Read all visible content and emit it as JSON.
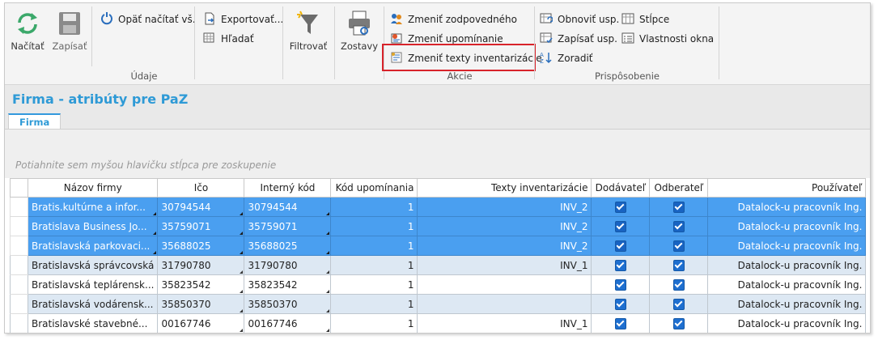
{
  "ribbon": {
    "udaje": {
      "label": "Údaje",
      "nacitat": "Načítať",
      "zapisat": "Zapísať",
      "opat_nacitat": "Opäť načítať vš.",
      "exportovat": "Exportovať...",
      "hladat": "Hľadať"
    },
    "filtrovat": "Filtrovať",
    "zostavy": "Zostavy",
    "akcie": {
      "label": "Akcie",
      "zmenit_zodpovedneho": "Zmeniť zodpovedného",
      "zmenit_upomienanie": "Zmeniť upomínanie",
      "zmenit_texty": "Zmeniť texty inventarizácie"
    },
    "prisposobenie": {
      "label": "Prispôsobenie",
      "obnovit_usp": "Obnoviť usp.",
      "zapisat_usp": "Zapísať usp.",
      "zoradit": "Zoradiť",
      "stlpce": "Stĺpce",
      "vlastnosti_okna": "Vlastnosti okna"
    }
  },
  "page": {
    "title": "Firma - atribúty pre PaZ",
    "tab": "Firma",
    "group_hint": "Potiahnite sem myšou hlavičku stĺpca pre zoskupenie"
  },
  "grid": {
    "columns": [
      "Názov firmy",
      "Ičo",
      "Interný kód",
      "Kód upomínania",
      "Texty inventarizácie",
      "Dodávateľ",
      "Odberateľ",
      "Používateľ"
    ],
    "rows": [
      {
        "nazov": "Bratis.kultúrne a infor...",
        "ico": "30794544",
        "kod": "30794544",
        "upom": "1",
        "texty": "INV_2",
        "user": "Datalock-u pracovník Ing."
      },
      {
        "nazov": "Bratislava Business Jo...",
        "ico": "35759071",
        "kod": "35759071",
        "upom": "1",
        "texty": "INV_2",
        "user": "Datalock-u pracovník Ing."
      },
      {
        "nazov": "Bratislavská parkovaci...",
        "ico": "35688025",
        "kod": "35688025",
        "upom": "1",
        "texty": "INV_2",
        "user": "Datalock-u pracovník Ing."
      },
      {
        "nazov": "Bratislavská správcovská",
        "ico": "31790780",
        "kod": "31790780",
        "upom": "1",
        "texty": "INV_1",
        "user": "Datalock-u pracovník Ing."
      },
      {
        "nazov": "Bratislavská teplárensk...",
        "ico": "35823542",
        "kod": "35823542",
        "upom": "1",
        "texty": "",
        "user": "Datalock-u pracovník Ing."
      },
      {
        "nazov": "Bratislavská vodárensk...",
        "ico": "35850370",
        "kod": "35850370",
        "upom": "1",
        "texty": "",
        "user": "Datalock-u pracovník Ing."
      },
      {
        "nazov": "Bratislavské stavebné...",
        "ico": "00167746",
        "kod": "00167746",
        "upom": "1",
        "texty": "INV_1",
        "user": "Datalock-u pracovník Ing."
      }
    ]
  },
  "colors": {
    "accent": "#2e9ad6",
    "selection": "#4a9ff0",
    "alt_row": "#dde8f3",
    "highlight": "#d8232a"
  }
}
